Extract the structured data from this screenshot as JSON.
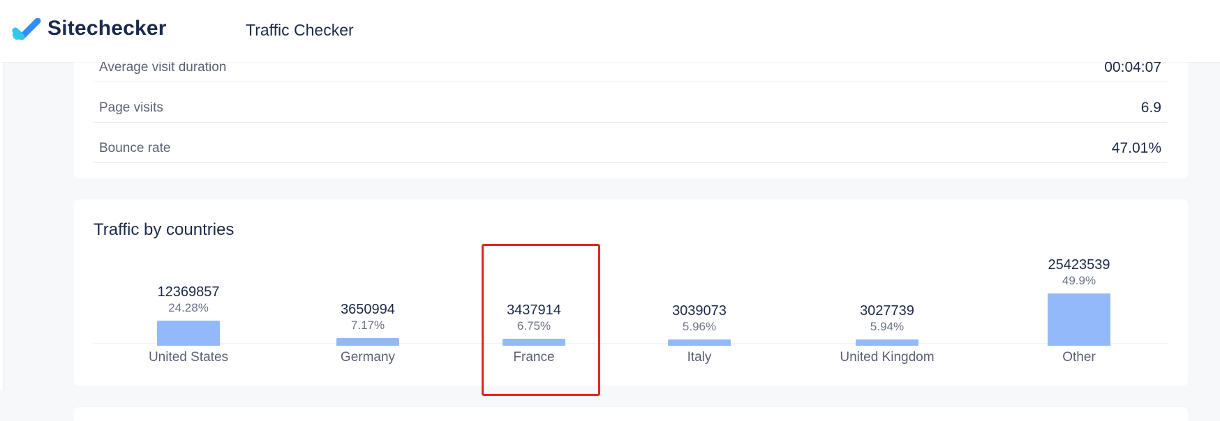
{
  "header": {
    "brand": "Sitechecker",
    "page_title": "Traffic Checker",
    "logo_icon": "check-logo-icon",
    "colors": {
      "logo_blue": "#2f8df5",
      "logo_cyan": "#35d0e6"
    }
  },
  "metrics": [
    {
      "label": "Average visit duration",
      "value": "00:04:07"
    },
    {
      "label": "Page visits",
      "value": "6.9"
    },
    {
      "label": "Bounce rate",
      "value": "47.01%"
    }
  ],
  "countries_card": {
    "title": "Traffic by countries"
  },
  "chart_data": {
    "type": "bar",
    "categories": [
      "United States",
      "Germany",
      "France",
      "Italy",
      "United Kingdom",
      "Other"
    ],
    "values": [
      12369857,
      3650994,
      3437914,
      3039073,
      3027739,
      25423539
    ],
    "value_labels": [
      "12369857",
      "3650994",
      "3437914",
      "3039073",
      "3027739",
      "25423539"
    ],
    "percent_labels": [
      "24.28%",
      "7.17%",
      "6.75%",
      "5.96%",
      "5.94%",
      "49.9%"
    ],
    "percents": [
      24.28,
      7.17,
      6.75,
      5.96,
      5.94,
      49.9
    ],
    "title": "Traffic by countries",
    "xlabel": "",
    "ylabel": "",
    "grid": false,
    "bar_color": "#93b9fb"
  },
  "highlight": {
    "target": "France",
    "color": "#e0261e"
  }
}
